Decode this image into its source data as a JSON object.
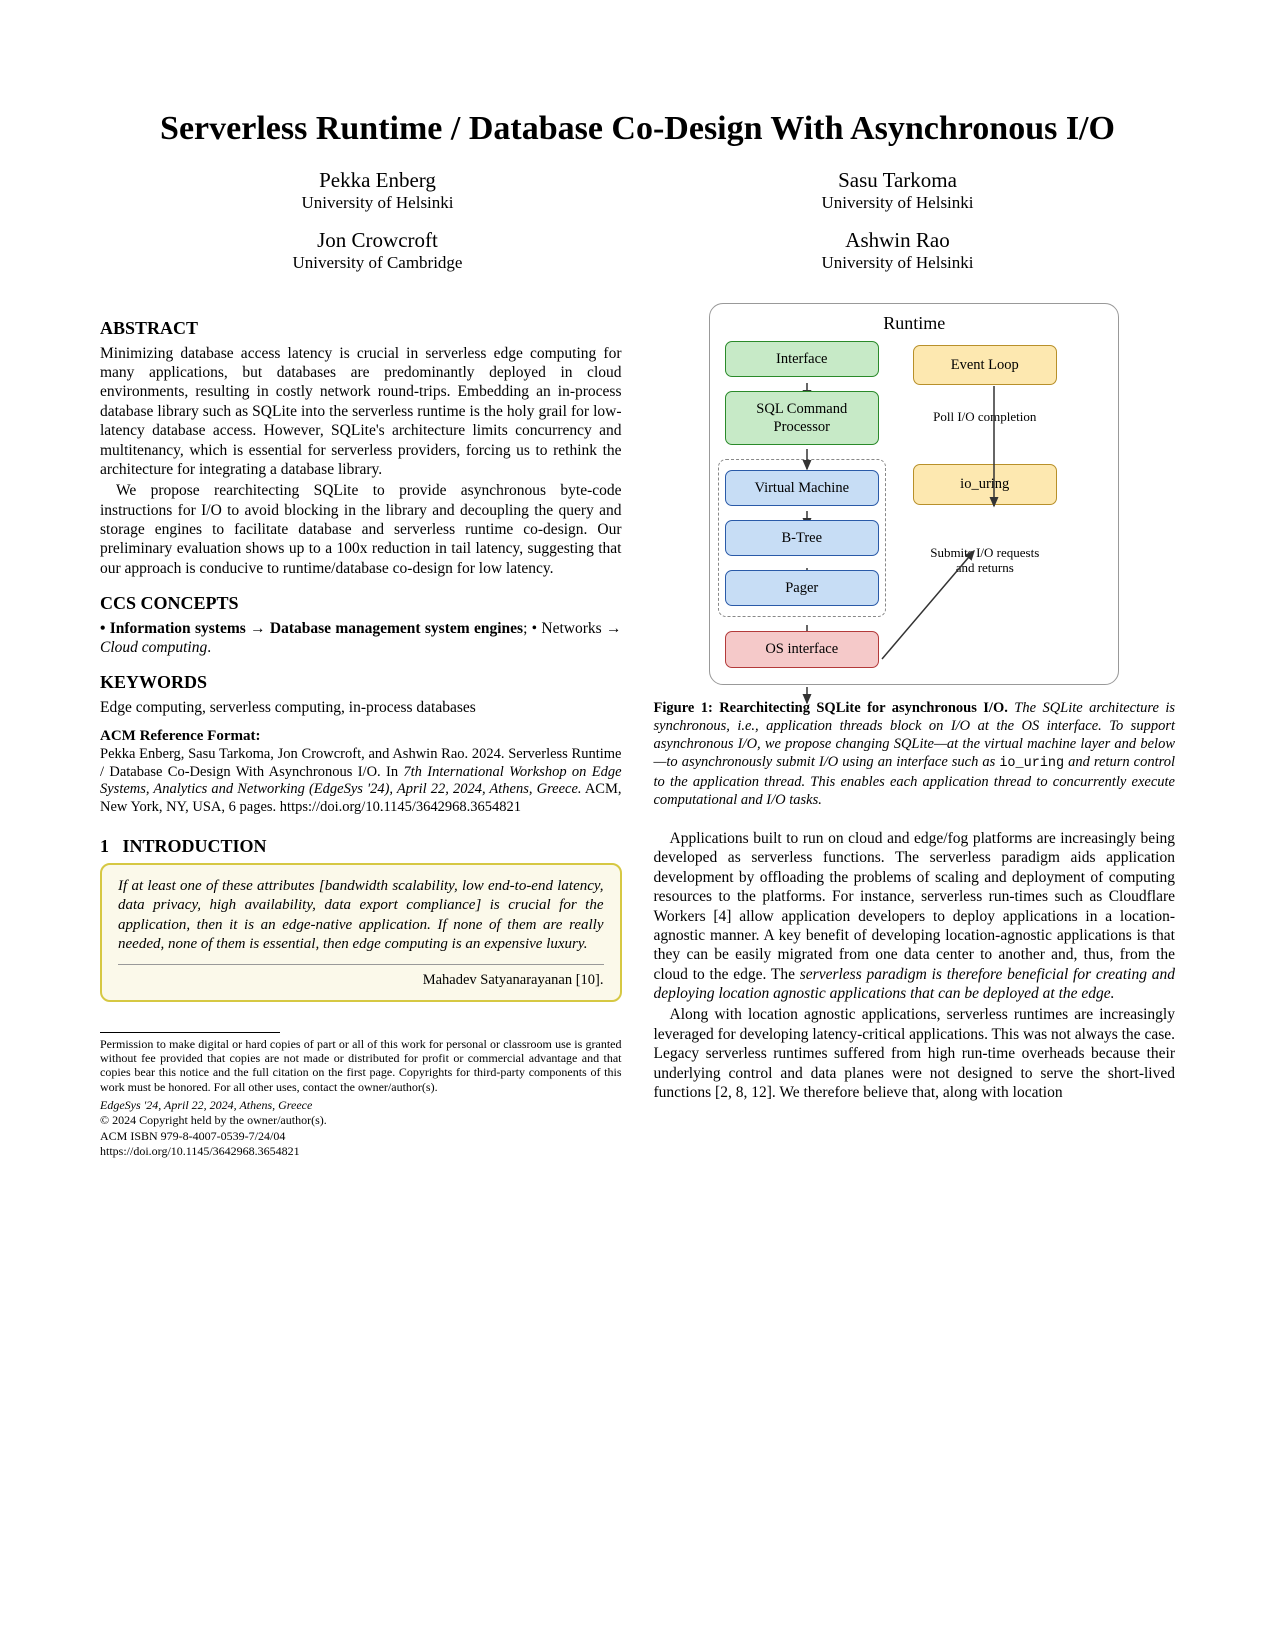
{
  "title": "Serverless Runtime / Database Co-Design With Asynchronous I/O",
  "authors": {
    "left": [
      {
        "name": "Pekka Enberg",
        "aff": "University of Helsinki"
      },
      {
        "name": "Jon Crowcroft",
        "aff": "University of Cambridge"
      }
    ],
    "right": [
      {
        "name": "Sasu Tarkoma",
        "aff": "University of Helsinki"
      },
      {
        "name": "Ashwin Rao",
        "aff": "University of Helsinki"
      }
    ]
  },
  "abstract_head": "ABSTRACT",
  "abstract_p1": "Minimizing database access latency is crucial in serverless edge computing for many applications, but databases are predominantly deployed in cloud environments, resulting in costly network round-trips. Embedding an in-process database library such as SQLite into the serverless runtime is the holy grail for low-latency database access. However, SQLite's architecture limits concurrency and multitenancy, which is essential for serverless providers, forcing us to rethink the architecture for integrating a database library.",
  "abstract_p2": "We propose rearchitecting SQLite to provide asynchronous byte-code instructions for I/O to avoid blocking in the library and decoupling the query and storage engines to facilitate database and serverless runtime co-design. Our preliminary evaluation shows up to a 100x reduction in tail latency, suggesting that our approach is conducive to runtime/database co-design for low latency.",
  "ccs_head": "CCS CONCEPTS",
  "ccs_body_prefix": "• Information systems → Database management system engines",
  "ccs_body_mid": "; • Networks → ",
  "ccs_body_italic": "Cloud computing",
  "keywords_head": "KEYWORDS",
  "keywords_body": "Edge computing, serverless computing, in-process databases",
  "acmref_head": "ACM Reference Format:",
  "acmref_body_a": "Pekka Enberg, Sasu Tarkoma, Jon Crowcroft, and Ashwin Rao. 2024. Serverless Runtime / Database Co-Design With Asynchronous I/O. In ",
  "acmref_body_i": "7th International Workshop on Edge Systems, Analytics and Networking (EdgeSys '24), April 22, 2024, Athens, Greece.",
  "acmref_body_b": " ACM, New York, NY, USA, 6 pages. https://doi.org/10.1145/3642968.3654821",
  "intro_num": "1",
  "intro_head": "INTRODUCTION",
  "quote_body": "If at least one of these attributes [bandwidth scalability, low end-to-end latency, data privacy, high availability, data export compliance] is crucial for the application, then it is an edge-native application. If none of them are really needed, none of them is essential, then edge computing is an expensive luxury.",
  "quote_attr": "Mahadev Satyanarayanan [10].",
  "permission": "Permission to make digital or hard copies of part or all of this work for personal or classroom use is granted without fee provided that copies are not made or distributed for profit or commercial advantage and that copies bear this notice and the full citation on the first page. Copyrights for third-party components of this work must be honored. For all other uses, contact the owner/author(s).",
  "venue": "EdgeSys '24, April 22, 2024, Athens, Greece",
  "copyright": "© 2024 Copyright held by the owner/author(s).",
  "isbn": "ACM ISBN 979-8-4007-0539-7/24/04",
  "doi": "https://doi.org/10.1145/3642968.3654821",
  "figure": {
    "runtime_label": "Runtime",
    "interface": "Interface",
    "sql_proc": "SQL Command Processor",
    "vm": "Virtual Machine",
    "btree": "B-Tree",
    "pager": "Pager",
    "os": "OS interface",
    "evloop": "Event Loop",
    "poll": "Poll I/O completion",
    "iouring": "io_uring",
    "submits": "Submits I/O requests and returns"
  },
  "figcap_title": "Figure 1: Rearchitecting SQLite for asynchronous I/O. ",
  "figcap_body_a": "The SQLite architecture is synchronous, i.e., application threads block on I/O at the OS interface. To support asynchronous I/O, we propose changing SQLite—at the virtual machine layer and below—to asynchronously submit I/O using an interface such as ",
  "figcap_mono": "io_uring",
  "figcap_body_b": " and return control to the application thread. This enables each application thread to concurrently execute computational and I/O tasks.",
  "col2_p1": "Applications built to run on cloud and edge/fog platforms are increasingly being developed as serverless functions. The serverless paradigm aids application development by offloading the problems of scaling and deployment of computing resources to the platforms. For instance, serverless run-times such as Cloudflare Workers [4] allow application developers to deploy applications in a location-agnostic manner. A key benefit of developing location-agnostic applications is that they can be easily migrated from one data center to another and, thus, from the cloud to the edge. The ",
  "col2_p1_i": "serverless paradigm is therefore beneficial for creating and deploying location agnostic applications that can be deployed at the edge.",
  "col2_p2": "Along with location agnostic applications, serverless runtimes are increasingly leveraged for developing latency-critical applications. This was not always the case. Legacy serverless runtimes suffered from high run-time overheads because their underlying control and data planes were not designed to serve the short-lived functions [2, 8, 12]. We therefore believe that, along with location"
}
